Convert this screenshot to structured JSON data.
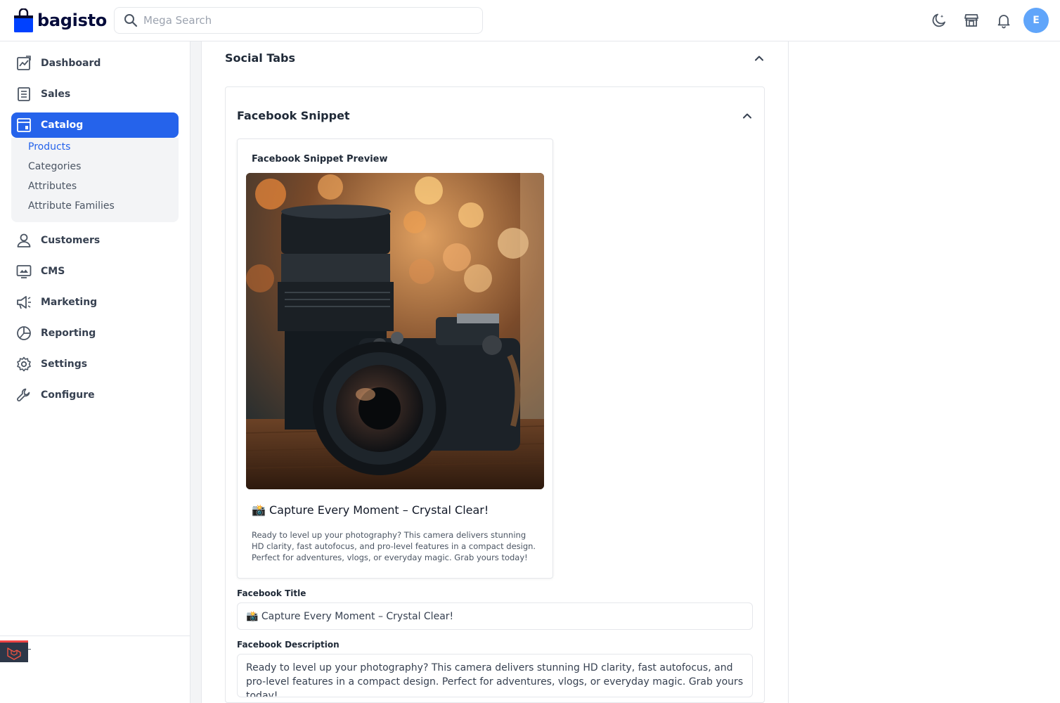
{
  "header": {
    "brand": "bagisto",
    "search_placeholder": "Mega Search",
    "avatar_initial": "E"
  },
  "sidebar": {
    "items": [
      {
        "label": "Dashboard",
        "icon": "dashboard-icon"
      },
      {
        "label": "Sales",
        "icon": "sales-icon"
      },
      {
        "label": "Catalog",
        "icon": "catalog-icon",
        "active": true
      },
      {
        "label": "Customers",
        "icon": "customers-icon"
      },
      {
        "label": "CMS",
        "icon": "cms-icon"
      },
      {
        "label": "Marketing",
        "icon": "marketing-icon"
      },
      {
        "label": "Reporting",
        "icon": "reporting-icon"
      },
      {
        "label": "Settings",
        "icon": "settings-icon"
      },
      {
        "label": "Configure",
        "icon": "configure-icon"
      }
    ],
    "catalog_sub": [
      {
        "label": "Products",
        "active": true
      },
      {
        "label": "Categories"
      },
      {
        "label": "Attributes"
      },
      {
        "label": "Attribute Families"
      }
    ]
  },
  "main": {
    "section_title": "Social Tabs",
    "snippet_title": "Facebook Snippet",
    "preview": {
      "label": "Facebook Snippet Preview",
      "image": "camera-photo",
      "title": "📸 Capture Every Moment – Crystal Clear!",
      "description": "Ready to level up your photography? This camera delivers stunning HD clarity, fast autofocus, and pro-level features in a compact design. Perfect for adventures, vlogs, or everyday magic. Grab yours today!"
    },
    "facebook_title_label": "Facebook Title",
    "facebook_title_value": "📸 Capture Every Moment – Crystal Clear!",
    "facebook_description_label": "Facebook Description",
    "facebook_description_value": "Ready to level up your photography? This camera delivers stunning HD clarity, fast autofocus, and pro-level features in a compact design. Perfect for adventures, vlogs, or everyday magic. Grab yours today!"
  },
  "colors": {
    "accent": "#2563eb",
    "avatar": "#60a5fa",
    "brand_bag": "#0041ff"
  }
}
